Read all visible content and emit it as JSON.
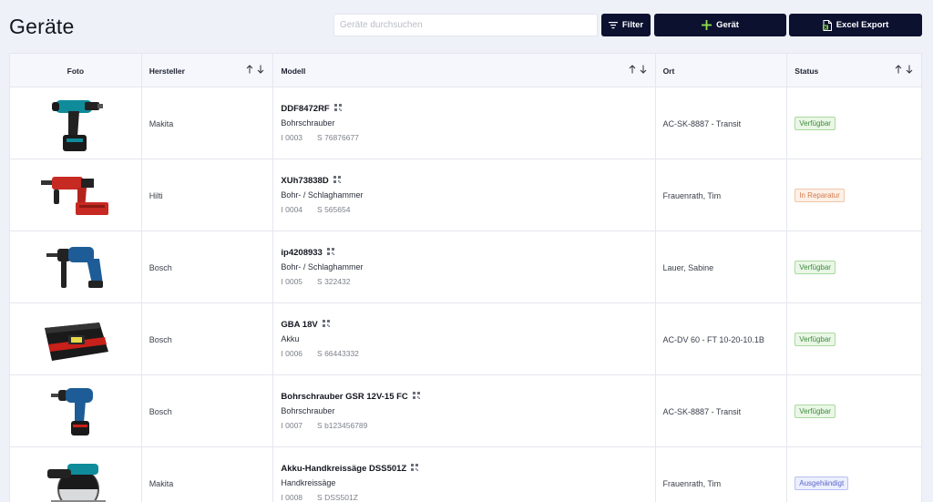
{
  "header": {
    "title": "Geräte",
    "search_placeholder": "Geräte durchsuchen",
    "filter_label": "Filter",
    "add_label": "Gerät",
    "export_label": "Excel Export"
  },
  "table": {
    "columns": {
      "foto": "Foto",
      "hersteller": "Hersteller",
      "modell": "Modell",
      "ort": "Ort",
      "status": "Status"
    },
    "rows": [
      {
        "image": "makita-drill",
        "hersteller": "Makita",
        "model": "DDF8472RF",
        "type": "Bohrschrauber",
        "inv": "I 0003",
        "serial": "S 76876677",
        "ort": "AC-SK-8887 - Transit",
        "status": "Verfügbar",
        "status_kind": "available"
      },
      {
        "image": "hilti-hammer",
        "hersteller": "Hilti",
        "model": "XUh73838D",
        "type": "Bohr- / Schlaghammer",
        "inv": "I 0004",
        "serial": "S 565654",
        "ort": "Frauenrath, Tim",
        "status": "In Reparatur",
        "status_kind": "repair"
      },
      {
        "image": "bosch-hammer",
        "hersteller": "Bosch",
        "model": "ip4208933",
        "type": "Bohr- / Schlaghammer",
        "inv": "I 0005",
        "serial": "S 322432",
        "ort": "Lauer, Sabine",
        "status": "Verfügbar",
        "status_kind": "available"
      },
      {
        "image": "bosch-battery",
        "hersteller": "Bosch",
        "model": "GBA 18V",
        "type": "Akku",
        "inv": "I 0006",
        "serial": "S 66443332",
        "ort": "AC-DV 60 - FT 10-20-10.1B",
        "status": "Verfügbar",
        "status_kind": "available"
      },
      {
        "image": "bosch-drill",
        "hersteller": "Bosch",
        "model": "Bohrschrauber GSR 12V-15 FC",
        "type": "Bohrschrauber",
        "inv": "I 0007",
        "serial": "S b123456789",
        "ort": "AC-SK-8887 - Transit",
        "status": "Verfügbar",
        "status_kind": "available"
      },
      {
        "image": "makita-saw",
        "hersteller": "Makita",
        "model": "Akku-Handkreissäge DSS501Z",
        "type": "Handkreissäge",
        "inv": "I 0008",
        "serial": "S DSS501Z",
        "ort": "Frauenrath, Tim",
        "status": "Ausgehändigt",
        "status_kind": "issued"
      }
    ]
  },
  "colors": {
    "primary_button": "#0d1130",
    "add_icon": "#8ee04a",
    "available": "#3e8a3e",
    "repair": "#d37a4d",
    "issued": "#5a66c8"
  }
}
